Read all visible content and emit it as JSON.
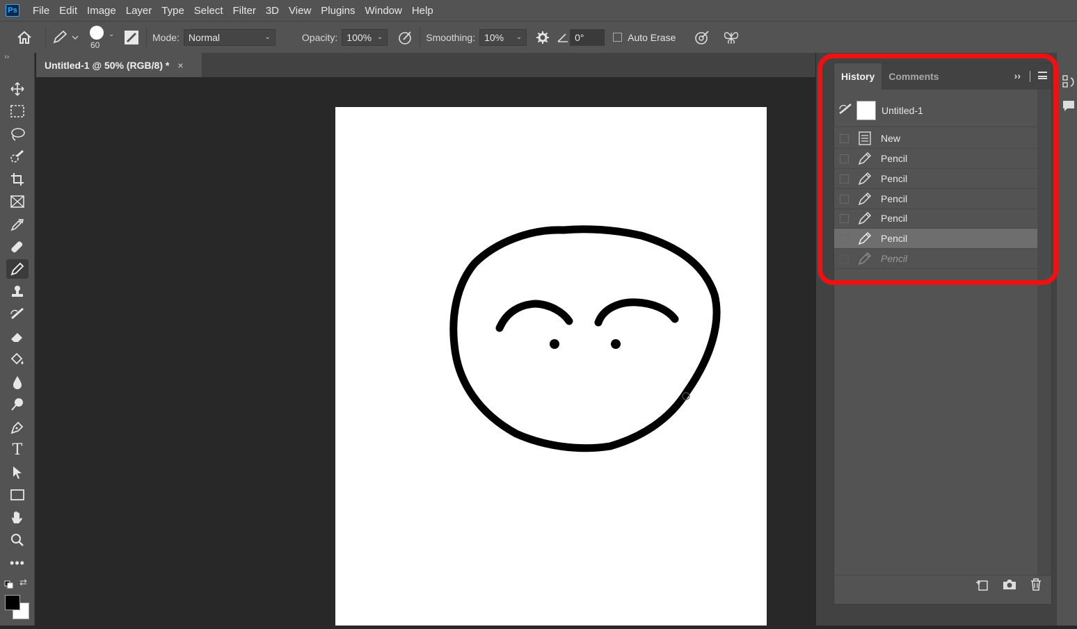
{
  "app": {
    "logo": "Ps"
  },
  "menu": [
    "File",
    "Edit",
    "Image",
    "Layer",
    "Type",
    "Select",
    "Filter",
    "3D",
    "View",
    "Plugins",
    "Window",
    "Help"
  ],
  "options": {
    "brush_size": "60",
    "mode_label": "Mode:",
    "mode_value": "Normal",
    "opacity_label": "Opacity:",
    "opacity_value": "100%",
    "smoothing_label": "Smoothing:",
    "smoothing_value": "10%",
    "angle_value": "0°",
    "auto_erase_label": "Auto Erase"
  },
  "document_tab": {
    "title": "Untitled-1 @ 50% (RGB/8) *",
    "close": "×"
  },
  "history_panel": {
    "tabs": [
      "History",
      "Comments"
    ],
    "snapshot_name": "Untitled-1",
    "items": [
      {
        "label": "New",
        "icon": "document-icon",
        "state": "normal"
      },
      {
        "label": "Pencil",
        "icon": "pencil-icon",
        "state": "normal"
      },
      {
        "label": "Pencil",
        "icon": "pencil-icon",
        "state": "normal"
      },
      {
        "label": "Pencil",
        "icon": "pencil-icon",
        "state": "normal"
      },
      {
        "label": "Pencil",
        "icon": "pencil-icon",
        "state": "normal"
      },
      {
        "label": "Pencil",
        "icon": "pencil-icon",
        "state": "selected"
      },
      {
        "label": "Pencil",
        "icon": "pencil-icon",
        "state": "undone"
      }
    ]
  },
  "colors": {
    "highlight": "#ee1111",
    "foreground": "#000000",
    "background": "#ffffff"
  }
}
